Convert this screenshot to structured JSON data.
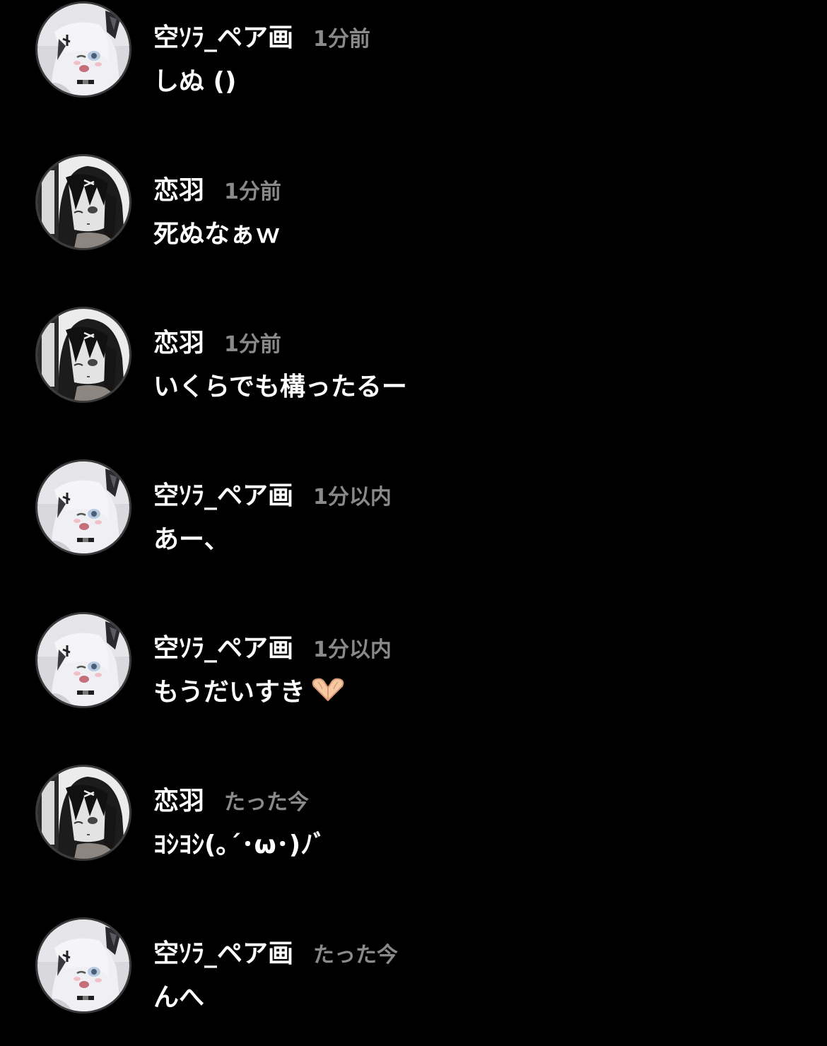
{
  "comments": [
    {
      "user": "空ｿﾗ_ペア画",
      "time": "1分前",
      "text": "しぬ ()",
      "avatar": "white-hair-girl-avatar"
    },
    {
      "user": "恋羽",
      "time": "1分前",
      "text": "死ぬなぁｗ",
      "avatar": "black-hair-girl-avatar"
    },
    {
      "user": "恋羽",
      "time": "1分前",
      "text": "いくらでも構ったるー",
      "avatar": "black-hair-girl-avatar"
    },
    {
      "user": "空ｿﾗ_ペア画",
      "time": "1分以内",
      "text": "あー、",
      "avatar": "white-hair-girl-avatar"
    },
    {
      "user": "空ｿﾗ_ペア画",
      "time": "1分以内",
      "text": "もうだいすき",
      "emoji": "heart-hands-emoji",
      "avatar": "white-hair-girl-avatar"
    },
    {
      "user": "恋羽",
      "time": "たった今",
      "text": "ﾖｼﾖｼ(｡´･ω･)ﾉﾞ",
      "avatar": "black-hair-girl-avatar"
    },
    {
      "user": "空ｿﾗ_ペア画",
      "time": "たった今",
      "text": "んへ",
      "avatar": "white-hair-girl-avatar"
    }
  ],
  "colors": {
    "background": "#000000",
    "name": "#ffffff",
    "timestamp": "#8a8a8a",
    "message": "#ffffff"
  }
}
